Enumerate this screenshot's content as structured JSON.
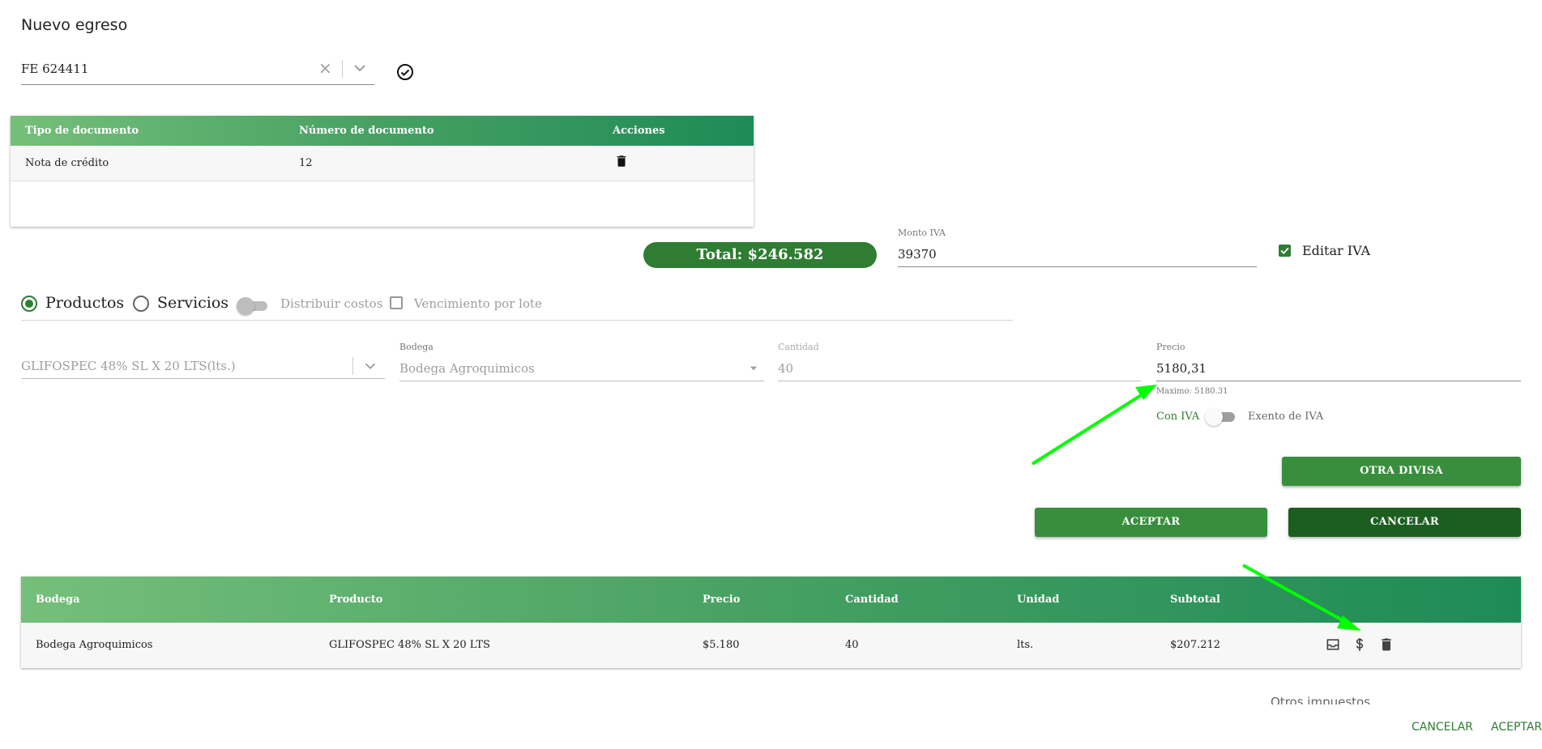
{
  "title": "Nuevo egreso",
  "document_select": {
    "value": "FE 624411"
  },
  "doc_table": {
    "headers": [
      "Tipo de documento",
      "Número de documento",
      "Acciones"
    ],
    "rows": [
      {
        "tipo": "Nota de crédito",
        "numero": "12"
      }
    ]
  },
  "total": "Total: $246.582",
  "monto_iva": {
    "label": "Monto IVA",
    "value": "39370"
  },
  "editar_iva": {
    "label": "Editar IVA",
    "checked": true
  },
  "tipo": {
    "productos": "Productos",
    "servicios": "Servicios",
    "distribuir_costos": "Distribuir costos",
    "vencimiento_lote": "Vencimiento por lote"
  },
  "producto_select": {
    "value": "GLIFOSPEC 48% SL X 20 LTS(lts.)"
  },
  "bodega": {
    "label": "Bodega",
    "value": "Bodega Agroquimicos"
  },
  "cantidad": {
    "label": "Cantidad",
    "value": "40"
  },
  "precio": {
    "label": "Precio",
    "value": "5180,31",
    "hint": "Maximo: 5180.31"
  },
  "iva_toggle": {
    "con": "Con IVA",
    "exento": "Exento de IVA"
  },
  "buttons": {
    "otra_divisa": "OTRA DIVISA",
    "aceptar": "ACEPTAR",
    "cancelar": "CANCELAR"
  },
  "prod_table": {
    "headers": [
      "Bodega",
      "Producto",
      "Precio",
      "Cantidad",
      "Unidad",
      "Subtotal"
    ],
    "rows": [
      {
        "bodega": "Bodega Agroquimicos",
        "producto": "GLIFOSPEC 48% SL X 20 LTS",
        "precio": "$5.180",
        "cantidad": "40",
        "unidad": "lts.",
        "subtotal": "$207.212"
      }
    ]
  },
  "otros_impuestos": "Otros impuestos",
  "footer": {
    "cancelar": "CANCELAR",
    "aceptar": "ACEPTAR"
  },
  "colors": {
    "primary": "#2e7d32",
    "annotation_arrow": "#00ff00"
  }
}
